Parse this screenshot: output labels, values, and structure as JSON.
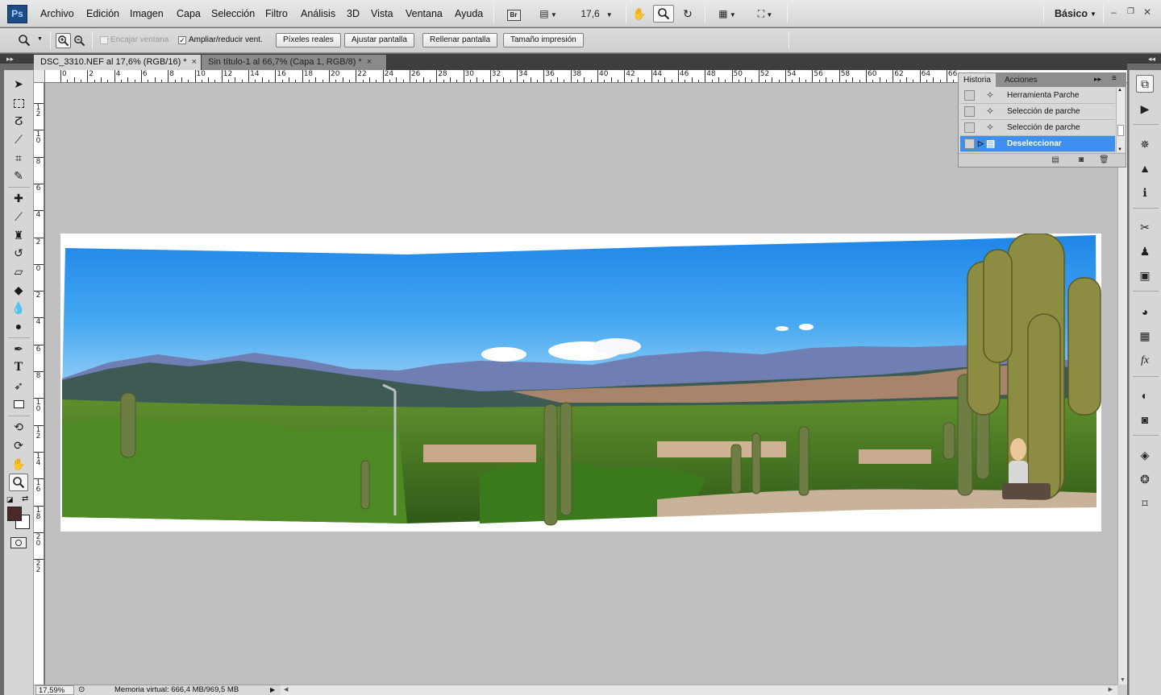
{
  "app": {
    "logo": "Ps",
    "menu": [
      "Archivo",
      "Edición",
      "Imagen",
      "Capa",
      "Selección",
      "Filtro",
      "Análisis",
      "3D",
      "Vista",
      "Ventana",
      "Ayuda"
    ],
    "bridge_label": "Br",
    "zoom_value": "17,6",
    "workspace": "Básico"
  },
  "options": {
    "tool_icon": "zoom-tool-icon",
    "checkbox_fit_window": {
      "label": "Encajar ventana",
      "checked": false,
      "disabled": true
    },
    "checkbox_resize_windows": {
      "label": "Ampliar/reducir vent.",
      "checked": true
    },
    "buttons": [
      "Píxeles reales",
      "Ajustar pantalla",
      "Rellenar pantalla",
      "Tamaño impresión"
    ]
  },
  "documents": [
    {
      "title": "DSC_3310.NEF al 17,6% (RGB/16) *",
      "active": true,
      "close": "×"
    },
    {
      "title": "Sin título-1 al 66,7% (Capa 1, RGB/8) *",
      "active": false,
      "close": "×"
    }
  ],
  "rulers": {
    "top": [
      "0",
      "2",
      "4",
      "6",
      "8",
      "10",
      "12",
      "14",
      "16",
      "18",
      "20",
      "22",
      "24",
      "26",
      "28",
      "30",
      "32",
      "34",
      "36",
      "38",
      "40",
      "42",
      "44",
      "46",
      "48",
      "50",
      "52",
      "54",
      "56",
      "58",
      "60",
      "62",
      "64",
      "66"
    ],
    "left": [
      "12",
      "10",
      "8",
      "6",
      "4",
      "2",
      "0",
      "2",
      "4",
      "6",
      "8",
      "10",
      "12",
      "14",
      "16",
      "18",
      "20",
      "22"
    ]
  },
  "history_panel": {
    "tabs": [
      "Historia",
      "Acciones"
    ],
    "items": [
      {
        "label": "Herramienta Parche",
        "icon": "patch-tool-icon",
        "selected": false
      },
      {
        "label": "Selección de parche",
        "icon": "patch-tool-icon",
        "selected": false
      },
      {
        "label": "Selección de parche",
        "icon": "patch-tool-icon",
        "selected": false
      },
      {
        "label": "Deseleccionar",
        "icon": "history-state-icon",
        "selected": true
      }
    ],
    "footer_icons": [
      "new-document-from-state-icon",
      "new-snapshot-icon",
      "delete-state-icon"
    ]
  },
  "status": {
    "zoom": "17,59%",
    "info": "Memoria virtual: 666,4 MB/969,5 MB"
  },
  "colors": {
    "foreground": "#4a2a26",
    "background": "#ffffff",
    "selection": "#3d8ff0"
  }
}
